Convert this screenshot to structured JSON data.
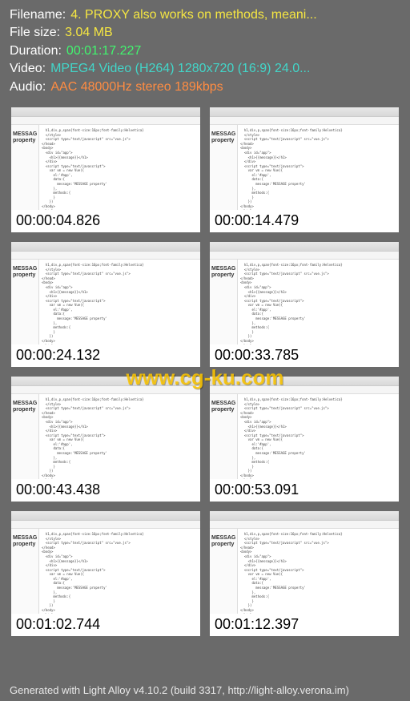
{
  "metadata": {
    "filename_label": "Filename:",
    "filename_value": "4. PROXY also works on methods, meani...",
    "filesize_label": "File size:",
    "filesize_value": "3.04 MB",
    "duration_label": "Duration:",
    "duration_value": "00:01:17.227",
    "video_label": "Video:",
    "video_value": "MPEG4 Video (H264) 1280x720 (16:9) 24.0...",
    "audio_label": "Audio:",
    "audio_value": "AAC 48000Hz stereo 189kbps"
  },
  "thumbnails": [
    {
      "timestamp": "00:00:04.826",
      "prop": "MESSAG\nproperty"
    },
    {
      "timestamp": "00:00:14.479",
      "prop": "MESSAG\nproperty"
    },
    {
      "timestamp": "00:00:24.132",
      "prop": "MESSAG\nproperty"
    },
    {
      "timestamp": "00:00:33.785",
      "prop": "MESSAG\nproperty"
    },
    {
      "timestamp": "00:00:43.438",
      "prop": "MESSAG\nproperty"
    },
    {
      "timestamp": "00:00:53.091",
      "prop": "MESSAG\nproperty"
    },
    {
      "timestamp": "00:01:02.744",
      "prop": "MESSAG\nproperty"
    },
    {
      "timestamp": "00:01:12.397",
      "prop": "MESSAG\nproperty"
    }
  ],
  "watermark": "www.cg-ku.com",
  "footer": "Generated with Light Alloy v4.10.2 (build 3317, http://light-alloy.verona.im)",
  "code_sample": "  h1,div,p,span{font-size:16px;font-family:Helvetica}\n  </style>\n  <script type=\"text/javascript\" src=\"vue.js\">\n</head>\n<body>\n  <div id=\"app\">\n    <h1>{{message}}</h1>\n  </div>\n  <script type=\"text/javascript\">\n    var vm = new Vue({\n      el:'#app',\n      data:{\n        message:'MESSAGE property'\n      },\n      methods:{\n      }\n    })\n</body>\n</html>"
}
